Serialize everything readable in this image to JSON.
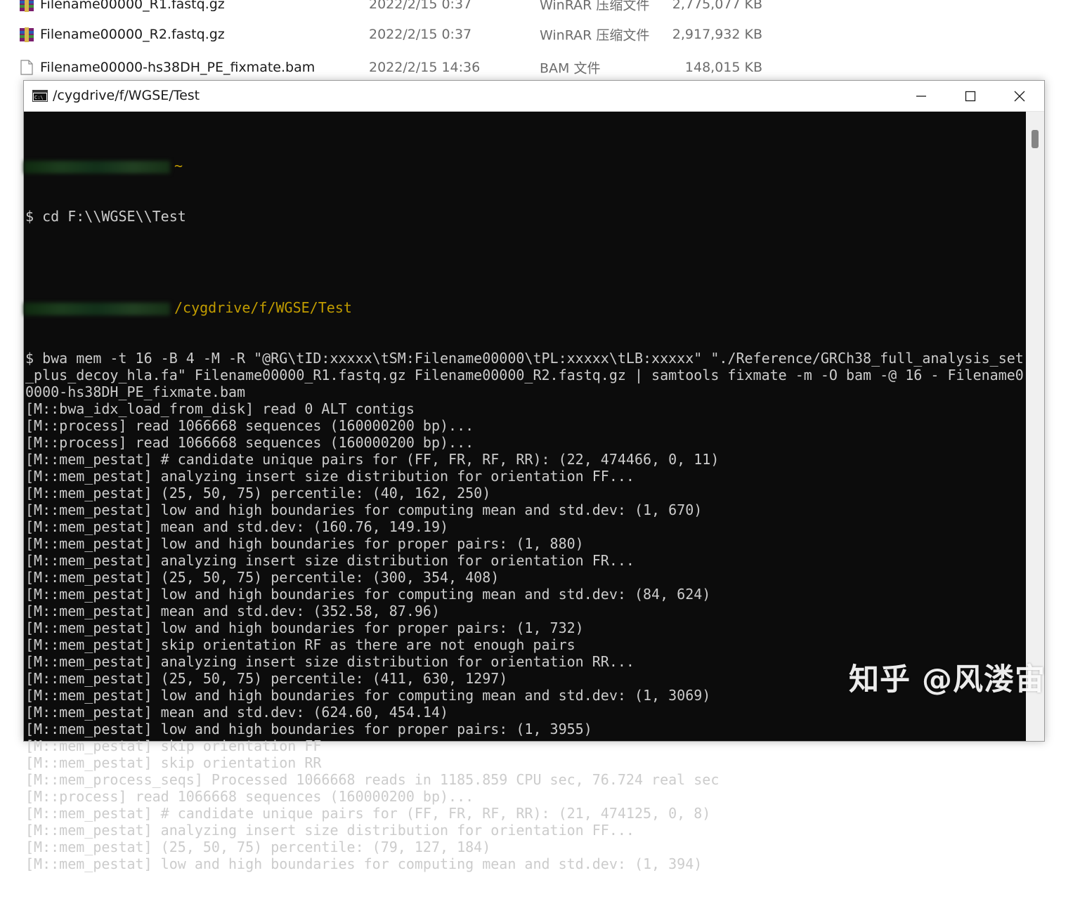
{
  "explorer": {
    "files": [
      {
        "name": "Filename00000_R1.fastq.gz",
        "date": "2022/2/15 0:37",
        "type": "WinRAR 压缩文件",
        "size": "2,775,077 KB",
        "icon": "winrar-archive-icon"
      },
      {
        "name": "Filename00000_R2.fastq.gz",
        "date": "2022/2/15 0:37",
        "type": "WinRAR 压缩文件",
        "size": "2,917,932 KB",
        "icon": "winrar-archive-icon"
      },
      {
        "name": "Filename00000-hs38DH_PE_fixmate.bam",
        "date": "2022/2/15 14:36",
        "type": "BAM 文件",
        "size": "148,015 KB",
        "icon": "blank-document-icon"
      }
    ]
  },
  "terminal": {
    "title": "/cygdrive/f/WGSE/Test",
    "prompt1_path": "~",
    "cmd1": "$ cd F:\\\\WGSE\\\\Test",
    "prompt2_path": "/cygdrive/f/WGSE/Test",
    "lines": [
      "$ bwa mem -t 16 -B 4 -M -R \"@RG\\tID:xxxxx\\tSM:Filename00000\\tPL:xxxxx\\tLB:xxxxx\" \"./Reference/GRCh38_full_analysis_set",
      "_plus_decoy_hla.fa\" Filename00000_R1.fastq.gz Filename00000_R2.fastq.gz | samtools fixmate -m -O bam -@ 16 - Filename0",
      "0000-hs38DH_PE_fixmate.bam",
      "[M::bwa_idx_load_from_disk] read 0 ALT contigs",
      "[M::process] read 1066668 sequences (160000200 bp)...",
      "[M::process] read 1066668 sequences (160000200 bp)...",
      "[M::mem_pestat] # candidate unique pairs for (FF, FR, RF, RR): (22, 474466, 0, 11)",
      "[M::mem_pestat] analyzing insert size distribution for orientation FF...",
      "[M::mem_pestat] (25, 50, 75) percentile: (40, 162, 250)",
      "[M::mem_pestat] low and high boundaries for computing mean and std.dev: (1, 670)",
      "[M::mem_pestat] mean and std.dev: (160.76, 149.19)",
      "[M::mem_pestat] low and high boundaries for proper pairs: (1, 880)",
      "[M::mem_pestat] analyzing insert size distribution for orientation FR...",
      "[M::mem_pestat] (25, 50, 75) percentile: (300, 354, 408)",
      "[M::mem_pestat] low and high boundaries for computing mean and std.dev: (84, 624)",
      "[M::mem_pestat] mean and std.dev: (352.58, 87.96)",
      "[M::mem_pestat] low and high boundaries for proper pairs: (1, 732)",
      "[M::mem_pestat] skip orientation RF as there are not enough pairs",
      "[M::mem_pestat] analyzing insert size distribution for orientation RR...",
      "[M::mem_pestat] (25, 50, 75) percentile: (411, 630, 1297)",
      "[M::mem_pestat] low and high boundaries for computing mean and std.dev: (1, 3069)",
      "[M::mem_pestat] mean and std.dev: (624.60, 454.14)",
      "[M::mem_pestat] low and high boundaries for proper pairs: (1, 3955)",
      "[M::mem_pestat] skip orientation FF",
      "[M::mem_pestat] skip orientation RR",
      "[M::mem_process_seqs] Processed 1066668 reads in 1185.859 CPU sec, 76.724 real sec",
      "[M::process] read 1066668 sequences (160000200 bp)...",
      "[M::mem_pestat] # candidate unique pairs for (FF, FR, RF, RR): (21, 474125, 0, 8)",
      "[M::mem_pestat] analyzing insert size distribution for orientation FF...",
      "[M::mem_pestat] (25, 50, 75) percentile: (79, 127, 184)",
      "[M::mem_pestat] low and high boundaries for computing mean and std.dev: (1, 394)"
    ]
  },
  "watermark": "知乎 @风溇宙",
  "colors": {
    "terminal_bg": "#0c0c0c",
    "terminal_text": "#cccccc",
    "prompt_path": "#c19c00"
  }
}
